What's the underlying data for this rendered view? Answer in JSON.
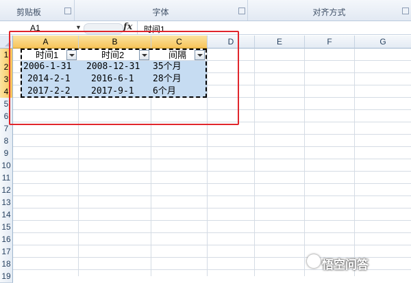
{
  "ribbon": {
    "groups": [
      "剪贴板",
      "字体",
      "对齐方式"
    ]
  },
  "formula_bar": {
    "name_box": "A1",
    "fx_label": "fx",
    "content": "时间1"
  },
  "columns": [
    "A",
    "B",
    "C",
    "D",
    "E",
    "F",
    "G"
  ],
  "rows": [
    "1",
    "2",
    "3",
    "4",
    "5",
    "6",
    "7",
    "8",
    "9",
    "10",
    "11",
    "12",
    "13",
    "14",
    "15",
    "16",
    "17",
    "18",
    "19"
  ],
  "table": {
    "headers": [
      "时间1",
      "时间2",
      "间隔"
    ],
    "data": [
      [
        "2006-1-31",
        "2008-12-31",
        "35个月"
      ],
      [
        "2014-2-1",
        "2016-6-1",
        "28个月"
      ],
      [
        "2017-2-2",
        "2017-9-1",
        "6个月"
      ]
    ]
  },
  "colors": {
    "selection": "#c6dcf2",
    "selected_header": "#f7c45a",
    "annotation_box": "#e0252b"
  },
  "watermark": "悟空问答"
}
